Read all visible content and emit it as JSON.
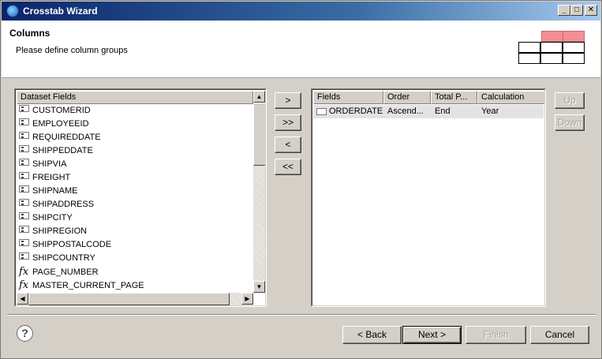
{
  "window": {
    "title": "Crosstab Wizard",
    "controls": [
      "_",
      "□",
      "✕"
    ]
  },
  "header": {
    "title": "Columns",
    "subtitle": "Please define column groups"
  },
  "left_panel": {
    "header": "Dataset Fields",
    "items": [
      {
        "label": "CUSTOMERID",
        "icon": "field-icon"
      },
      {
        "label": "EMPLOYEEID",
        "icon": "field-icon"
      },
      {
        "label": "REQUIREDDATE",
        "icon": "field-icon"
      },
      {
        "label": "SHIPPEDDATE",
        "icon": "field-icon"
      },
      {
        "label": "SHIPVIA",
        "icon": "field-icon"
      },
      {
        "label": "FREIGHT",
        "icon": "field-icon"
      },
      {
        "label": "SHIPNAME",
        "icon": "field-icon"
      },
      {
        "label": "SHIPADDRESS",
        "icon": "field-icon"
      },
      {
        "label": "SHIPCITY",
        "icon": "field-icon"
      },
      {
        "label": "SHIPREGION",
        "icon": "field-icon"
      },
      {
        "label": "SHIPPOSTALCODE",
        "icon": "field-icon"
      },
      {
        "label": "SHIPCOUNTRY",
        "icon": "field-icon"
      },
      {
        "label": "PAGE_NUMBER",
        "icon": "fx-icon"
      },
      {
        "label": "MASTER_CURRENT_PAGE",
        "icon": "fx-icon"
      }
    ],
    "fx_glyph": "fx"
  },
  "move_buttons": {
    "add": ">",
    "add_all": ">>",
    "remove": "<",
    "remove_all": "<<"
  },
  "right_panel": {
    "columns": [
      "Fields",
      "Order",
      "Total P...",
      "Calculation"
    ],
    "rows": [
      {
        "field": "ORDERDATE",
        "order": "Ascend...",
        "total": "End",
        "calculation": "Year"
      }
    ]
  },
  "order_buttons": {
    "up": "Up",
    "down": "Down"
  },
  "footer": {
    "help": "?",
    "back": "< Back",
    "next": "Next >",
    "finish": "Finish",
    "cancel": "Cancel"
  }
}
